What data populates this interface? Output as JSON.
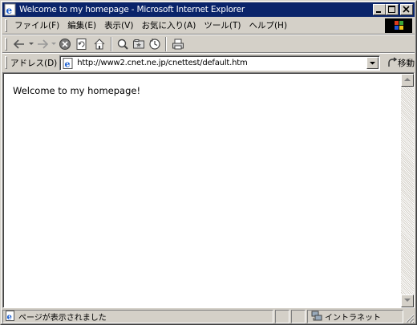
{
  "window": {
    "title": "Welcome to my homepage - Microsoft Internet Explorer"
  },
  "menu": {
    "items": [
      {
        "label": "ファイル(F)"
      },
      {
        "label": "編集(E)"
      },
      {
        "label": "表示(V)"
      },
      {
        "label": "お気に入り(A)"
      },
      {
        "label": "ツール(T)"
      },
      {
        "label": "ヘルプ(H)"
      }
    ]
  },
  "toolbar": {
    "icons": [
      "back-icon",
      "forward-icon",
      "stop-icon",
      "refresh-icon",
      "home-icon",
      "search-icon",
      "favorites-icon",
      "history-icon",
      "print-icon"
    ]
  },
  "address": {
    "label": "アドレス(D)",
    "url": "http://www2.cnet.ne.jp/cnettest/default.htm",
    "go_label": "移動"
  },
  "page": {
    "text": "Welcome to my homepage!"
  },
  "status": {
    "message": "ページが表示されました",
    "zone": "イントラネット"
  }
}
